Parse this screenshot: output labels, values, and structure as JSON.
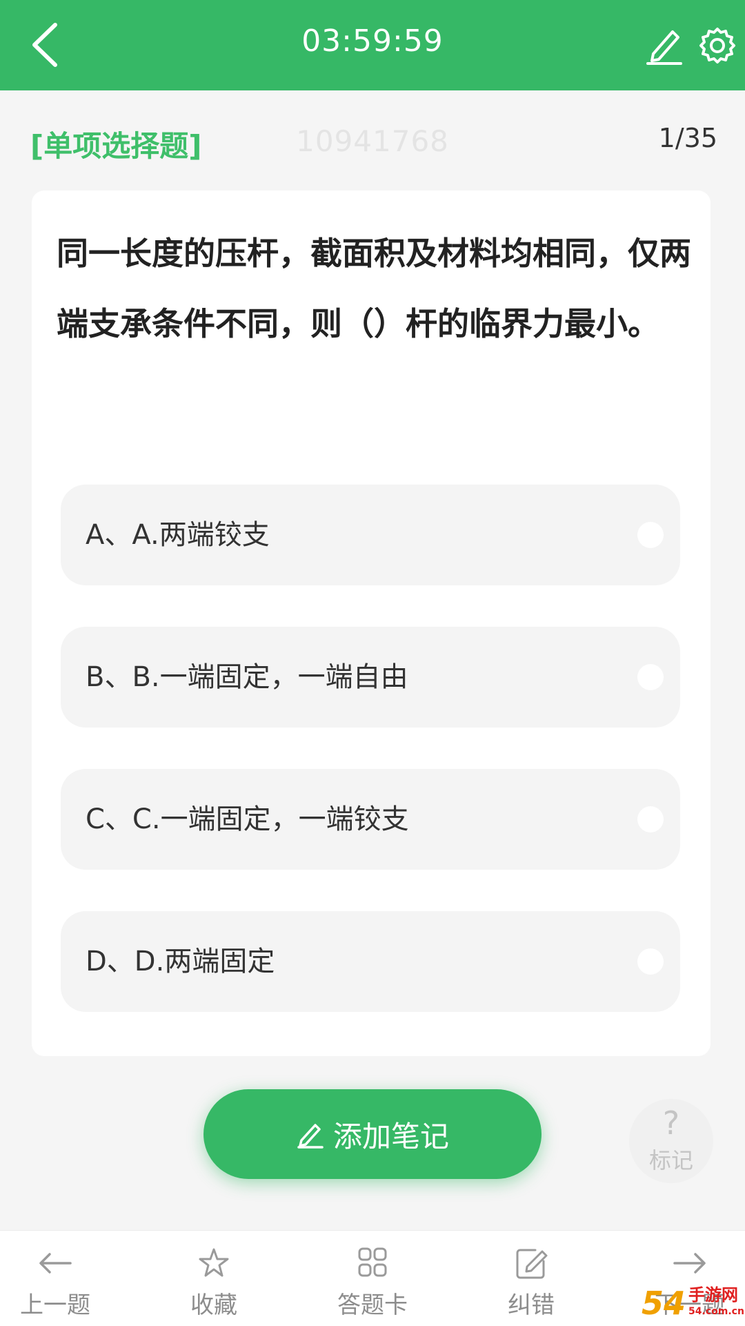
{
  "header": {
    "timer": "03:59:59",
    "back_icon": "chevron-left-icon",
    "edit_icon": "pen-icon",
    "settings_icon": "gear-icon",
    "accent_color": "#36b866"
  },
  "question": {
    "type_label": "[单项选择题]",
    "id": "10941768",
    "progress": "1/35",
    "stem": "同一长度的压杆，截面积及材料均相同，仅两端支承条件不同，则（）杆的临界力最小。",
    "options": [
      {
        "label": "A、A.两端铰支"
      },
      {
        "label": "B、B.一端固定，一端自由"
      },
      {
        "label": "C、C.一端固定，一端铰支"
      },
      {
        "label": "D、D.两端固定"
      }
    ]
  },
  "actions": {
    "add_note_label": "添加笔记",
    "mark_symbol": "?",
    "mark_label": "标记"
  },
  "bottom_nav": [
    {
      "label": "上一题",
      "icon": "arrow-left-icon"
    },
    {
      "label": "收藏",
      "icon": "star-icon"
    },
    {
      "label": "答题卡",
      "icon": "grid-icon"
    },
    {
      "label": "纠错",
      "icon": "edit-icon"
    },
    {
      "label": "下一题",
      "icon": "arrow-right-icon"
    }
  ],
  "watermark": {
    "text_big": "54",
    "text_small": "手游网",
    "text_domain": "54.com.cn"
  }
}
